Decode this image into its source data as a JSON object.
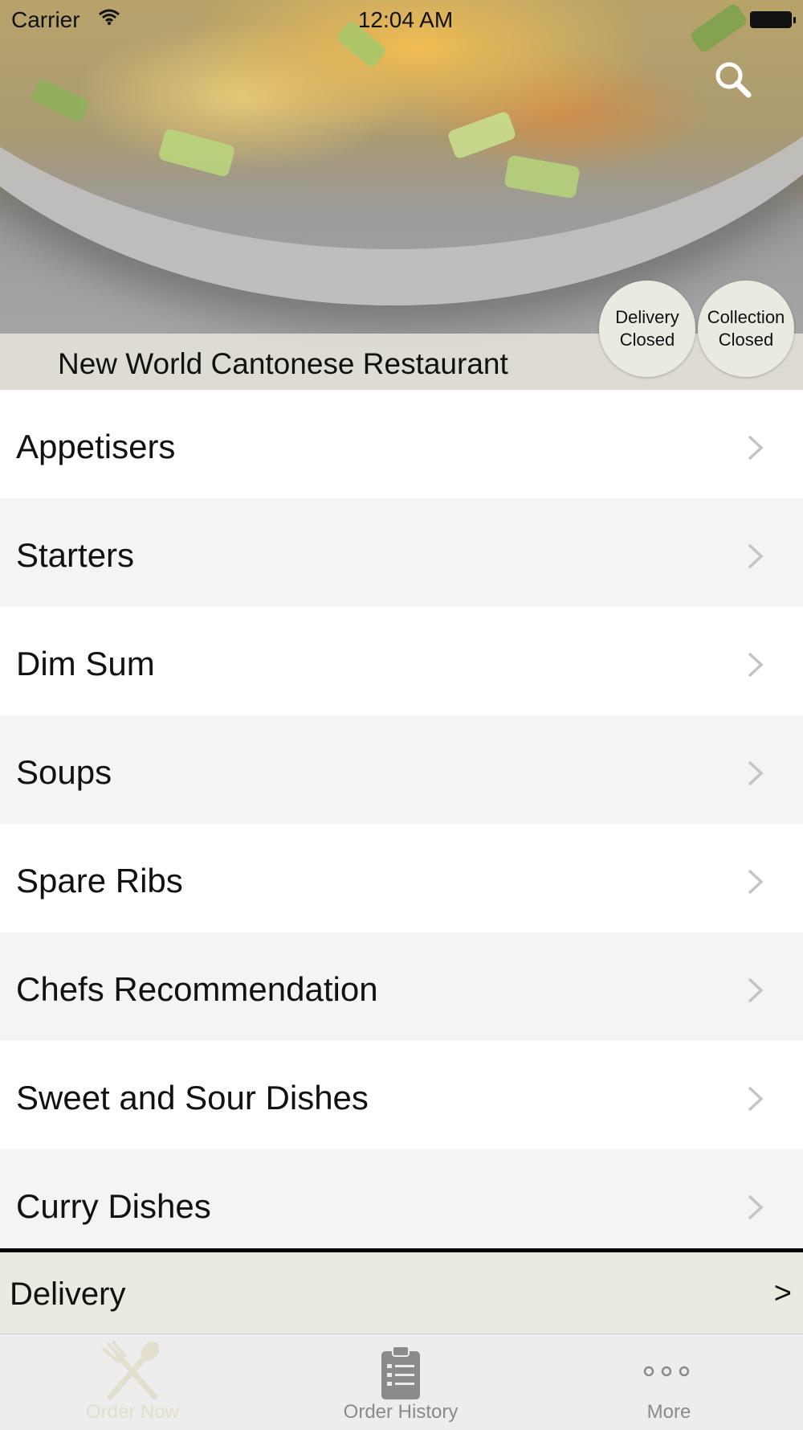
{
  "status_bar": {
    "carrier": "Carrier",
    "time": "12:04 AM"
  },
  "header": {
    "restaurant_name": "New World Cantonese Restaurant",
    "search_icon": "search-icon",
    "delivery_status": {
      "line1": "Delivery",
      "line2": "Closed"
    },
    "collection_status": {
      "line1": "Collection",
      "line2": "Closed"
    }
  },
  "menu": {
    "chevron_icon": "chevron-right-icon",
    "items": [
      {
        "label": "Appetisers"
      },
      {
        "label": "Starters"
      },
      {
        "label": "Dim Sum"
      },
      {
        "label": "Soups"
      },
      {
        "label": "Spare Ribs"
      },
      {
        "label": "Chefs Recommendation"
      },
      {
        "label": "Sweet and Sour Dishes"
      },
      {
        "label": "Curry Dishes"
      }
    ]
  },
  "order_mode_bar": {
    "label": "Delivery",
    "arrow": ">"
  },
  "tab_bar": {
    "tabs": [
      {
        "label": "Order Now",
        "icon": "fork-knife-icon",
        "selected": true
      },
      {
        "label": "Order History",
        "icon": "clipboard-icon",
        "selected": false
      },
      {
        "label": "More",
        "icon": "more-dots-icon",
        "selected": false
      }
    ]
  },
  "colors": {
    "band": "#e2e0d6",
    "selected_tab": "#e3dfcd",
    "tab_text": "#8a8a8a",
    "alt_row": "#f3f4f6"
  }
}
